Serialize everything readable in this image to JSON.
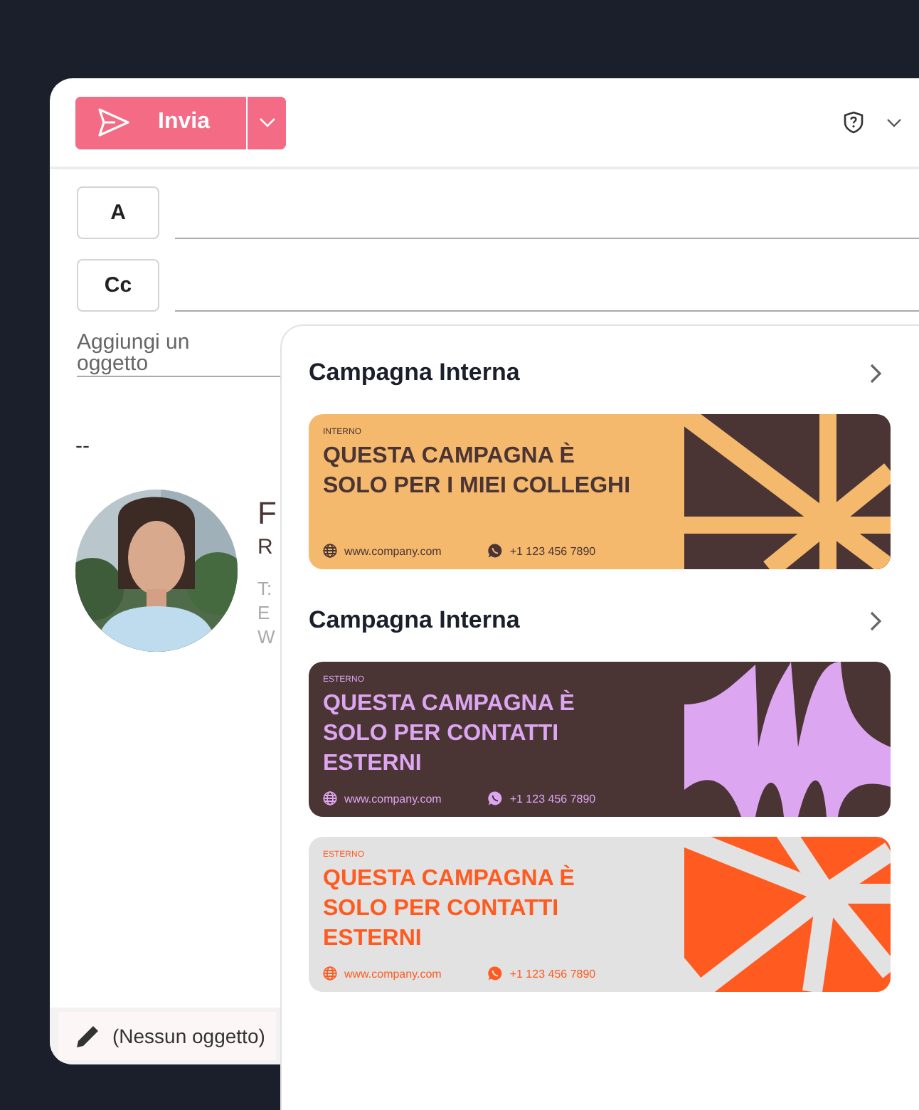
{
  "toolbar": {
    "send_button": {
      "label": "Invia"
    }
  },
  "recipients": [
    {
      "label": "A"
    },
    {
      "label": "Cc"
    }
  ],
  "subject": {
    "placeholder": "Aggiungi un oggetto"
  },
  "signature": {
    "separator": "--",
    "name": "F",
    "role": "R",
    "lines": [
      "T:",
      "E",
      "W"
    ]
  },
  "footer": {
    "draft": "(Nessun oggetto)"
  },
  "panel": {
    "sections": [
      {
        "title": "Campagna Interna",
        "banners": [
          {
            "kind": "grid",
            "label": "INTERNO",
            "headline": "QUESTA CAMPAGNA È SOLO PER I MIEI COLLEGHI",
            "website": "www.company.com",
            "phone": "+1 123 456 7890"
          }
        ]
      },
      {
        "title": "Campagna Interna",
        "banners": [
          {
            "kind": "blob",
            "label": "ESTERNO",
            "headline": "QUESTA CAMPAGNA È SOLO PER CONTATTI ESTERNI",
            "website": "www.company.com",
            "phone": "+1 123 456 7890"
          },
          {
            "kind": "rays",
            "label": "ESTERNO",
            "headline": "QUESTA CAMPAGNA È SOLO PER CONTATTI ESTERNI",
            "website": "www.company.com",
            "phone": "+1 123 456 7890"
          }
        ]
      }
    ]
  }
}
